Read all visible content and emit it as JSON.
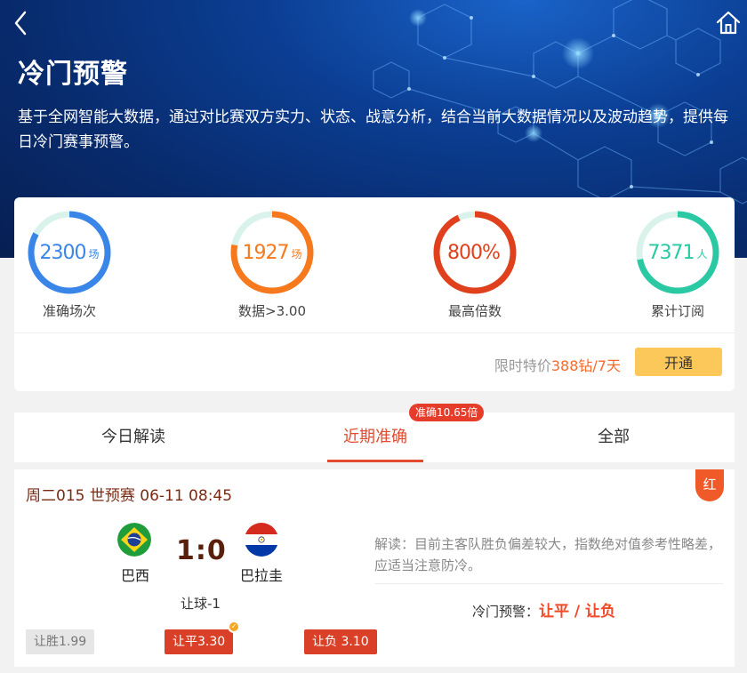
{
  "header": {
    "title": "冷门预警",
    "description": "基于全网智能大数据，通过对比赛双方实力、状态、战意分析，结合当前大数据情况以及波动趋势，提供每日冷门赛事预警。"
  },
  "stats": [
    {
      "value": "2300",
      "unit": "场",
      "label": "准确场次",
      "color": "#3a86e8",
      "progress": 0.83
    },
    {
      "value": "1927",
      "unit": "场",
      "label": "数据>3.00",
      "color": "#f7791e",
      "progress": 0.78
    },
    {
      "value": "800%",
      "unit": "",
      "label": "最高倍数",
      "color": "#e0401c",
      "progress": 0.93
    },
    {
      "value": "7371",
      "unit": "人",
      "label": "累计订阅",
      "color": "#2ac9a4",
      "progress": 0.72
    }
  ],
  "pricing": {
    "prefix": "限时特价",
    "price": "388钻/7天",
    "button": "开通"
  },
  "tabs": [
    {
      "label": "今日解读",
      "active": false
    },
    {
      "label": "近期准确",
      "active": true
    },
    {
      "label": "全部",
      "active": false
    }
  ],
  "tab_badge": "准确10.65倍",
  "match": {
    "header": "周二015 世预赛 06-11 08:45",
    "result": "红",
    "home": {
      "name": "巴西",
      "flag": "brazil-flag"
    },
    "away": {
      "name": "巴拉圭",
      "flag": "paraguay-flag"
    },
    "score": "1:0",
    "handicap": "让球-1",
    "analysis": "解读：目前主客队胜负偏差较大，指数绝对值参考性略差，应适当注意防冷。",
    "warning_label": "冷门预警：",
    "warning_value": "让平 / 让负",
    "odds": [
      {
        "label": "让胜1.99",
        "style": "grey"
      },
      {
        "label": "让平3.30",
        "style": "red"
      },
      {
        "label": "让负 3.10",
        "style": "red"
      }
    ],
    "check_mark": "✓"
  },
  "colors": {
    "accent": "#e24b2f",
    "button_yellow": "#fcc859",
    "hero_blue": "#0b3e93"
  }
}
